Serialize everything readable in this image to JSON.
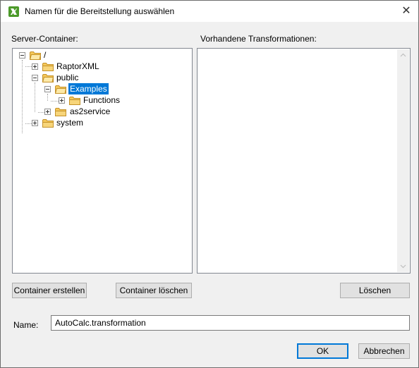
{
  "window": {
    "title": "Namen für die Bereitstellung auswählen",
    "close_glyph": "✕"
  },
  "server_container": {
    "label": "Server-Container:",
    "tree": {
      "root": "/",
      "raptorxml": "RaptorXML",
      "public": "public",
      "examples": "Examples",
      "functions": "Functions",
      "as2service": "as2service",
      "system": "system"
    },
    "selected": "Examples"
  },
  "transformations": {
    "label": "Vorhandene Transformationen:",
    "items": []
  },
  "buttons": {
    "create": "Container erstellen",
    "delete_container": "Container löschen",
    "delete": "Löschen",
    "ok": "OK",
    "cancel": "Abbrechen"
  },
  "name_field": {
    "label": "Name:",
    "value": "AutoCalc.transformation"
  },
  "icons": {
    "app": "app-logo-icon",
    "folder": "folder-icon",
    "expand": "plus-box-icon",
    "collapse": "minus-box-icon",
    "scroll_up": "chevron-up-icon",
    "scroll_down": "chevron-down-icon"
  },
  "colors": {
    "selection": "#0078d7",
    "folder_fill": "#f5c85a",
    "folder_stroke": "#c4922a"
  }
}
